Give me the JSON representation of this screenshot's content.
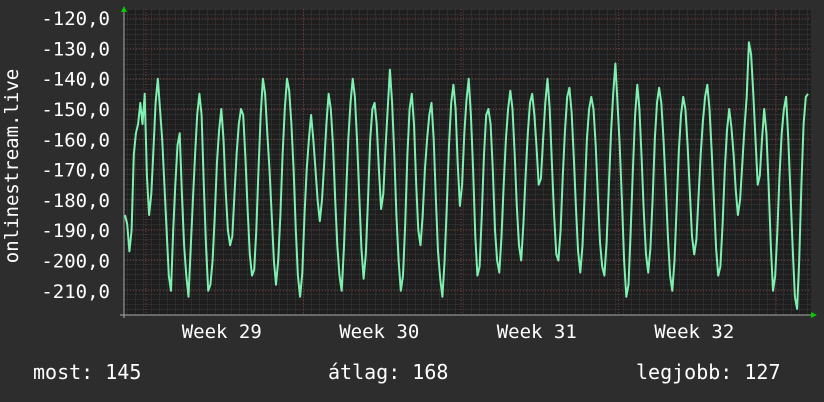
{
  "chart_data": {
    "type": "line",
    "ylabel": "onlinestream.live",
    "ylim": [
      -218,
      -117
    ],
    "yticks": [
      "-120,0",
      "-130,0",
      "-140,0",
      "-150,0",
      "-160,0",
      "-170,0",
      "-180,0",
      "-190,0",
      "-200,0",
      "-210,0"
    ],
    "ytick_values": [
      -120,
      -130,
      -140,
      -150,
      -160,
      -170,
      -180,
      -190,
      -200,
      -210
    ],
    "x_categories": [
      "Week 29",
      "Week 30",
      "Week 31",
      "Week 32"
    ],
    "grid": true,
    "legend": "none",
    "series": [
      {
        "color": "#7ef0b0",
        "values": [
          -185,
          -188,
          -197,
          -190,
          -165,
          -158,
          -155,
          -148,
          -155,
          -145,
          -172,
          -185,
          -178,
          -163,
          -148,
          -140,
          -150,
          -160,
          -175,
          -190,
          -205,
          -210,
          -190,
          -175,
          -162,
          -158,
          -178,
          -195,
          -205,
          -212,
          -196,
          -180,
          -165,
          -152,
          -145,
          -152,
          -175,
          -195,
          -210,
          -208,
          -200,
          -185,
          -168,
          -157,
          -150,
          -160,
          -177,
          -190,
          -195,
          -192,
          -178,
          -165,
          -155,
          -150,
          -152,
          -166,
          -183,
          -198,
          -205,
          -203,
          -190,
          -170,
          -152,
          -140,
          -145,
          -158,
          -170,
          -185,
          -200,
          -208,
          -200,
          -185,
          -165,
          -150,
          -140,
          -144,
          -155,
          -170,
          -190,
          -205,
          -212,
          -204,
          -185,
          -170,
          -160,
          -152,
          -160,
          -170,
          -180,
          -187,
          -180,
          -168,
          -155,
          -145,
          -150,
          -162,
          -180,
          -195,
          -205,
          -210,
          -196,
          -178,
          -160,
          -148,
          -140,
          -146,
          -160,
          -178,
          -196,
          -206,
          -198,
          -180,
          -160,
          -150,
          -148,
          -155,
          -170,
          -183,
          -178,
          -163,
          -150,
          -137,
          -148,
          -165,
          -185,
          -200,
          -210,
          -205,
          -188,
          -165,
          -150,
          -145,
          -155,
          -175,
          -190,
          -195,
          -185,
          -170,
          -160,
          -152,
          -148,
          -160,
          -180,
          -197,
          -206,
          -212,
          -200,
          -182,
          -162,
          -148,
          -142,
          -150,
          -168,
          -182,
          -175,
          -158,
          -147,
          -140,
          -152,
          -170,
          -192,
          -205,
          -202,
          -185,
          -165,
          -152,
          -150,
          -155,
          -170,
          -190,
          -200,
          -204,
          -192,
          -175,
          -160,
          -150,
          -144,
          -150,
          -165,
          -182,
          -195,
          -200,
          -188,
          -172,
          -158,
          -148,
          -145,
          -152,
          -163,
          -175,
          -173,
          -160,
          -148,
          -140,
          -150,
          -168,
          -185,
          -198,
          -200,
          -190,
          -172,
          -157,
          -146,
          -143,
          -151,
          -166,
          -183,
          -197,
          -204,
          -195,
          -178,
          -160,
          -150,
          -146,
          -150,
          -162,
          -178,
          -194,
          -202,
          -205,
          -194,
          -176,
          -158,
          -145,
          -135,
          -148,
          -162,
          -180,
          -200,
          -212,
          -208,
          -190,
          -170,
          -152,
          -142,
          -150,
          -166,
          -184,
          -198,
          -204,
          -196,
          -180,
          -160,
          -148,
          -143,
          -148,
          -160,
          -175,
          -192,
          -205,
          -210,
          -200,
          -182,
          -164,
          -152,
          -146,
          -150,
          -162,
          -177,
          -192,
          -198,
          -193,
          -179,
          -165,
          -154,
          -146,
          -142,
          -150,
          -164,
          -180,
          -196,
          -205,
          -202,
          -188,
          -170,
          -157,
          -150,
          -156,
          -165,
          -177,
          -185,
          -180,
          -168,
          -156,
          -146,
          -128,
          -132,
          -145,
          -160,
          -175,
          -172,
          -160,
          -150,
          -158,
          -175,
          -195,
          -210,
          -205,
          -190,
          -172,
          -158,
          -150,
          -146,
          -160,
          -178,
          -196,
          -212,
          -216,
          -200,
          -175,
          -155,
          -146,
          -145
        ]
      }
    ]
  },
  "stats": {
    "now": "most: 145",
    "avg": "átlag: 168",
    "best": "legjobb: 127"
  }
}
